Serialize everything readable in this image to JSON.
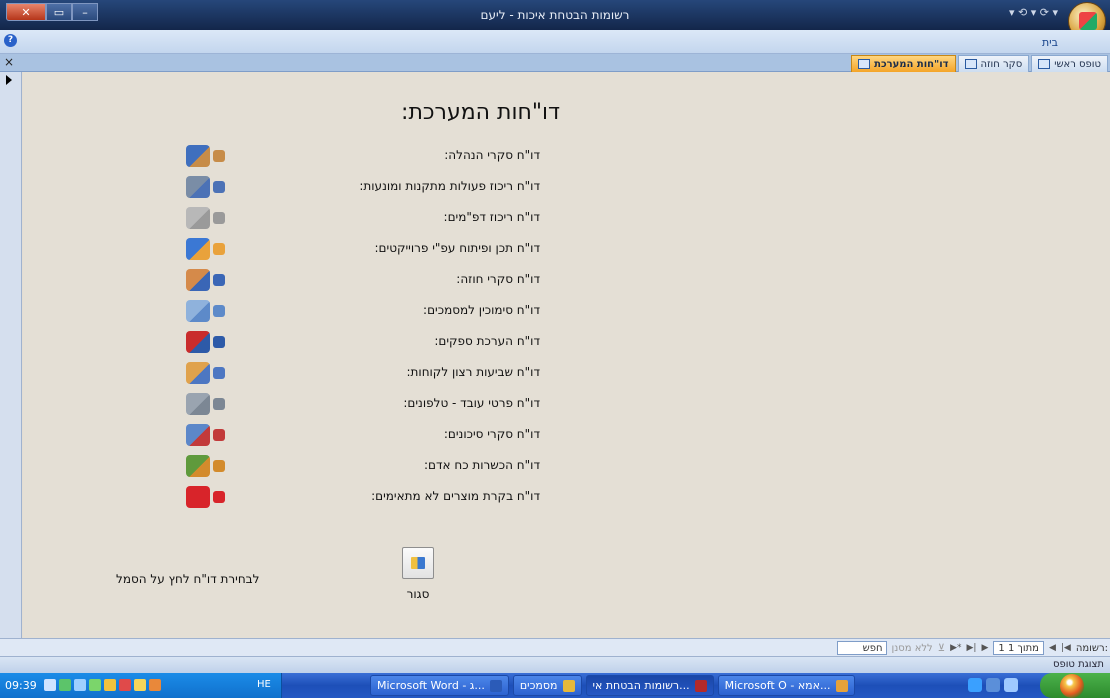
{
  "window": {
    "title": "רשומות הבטחת איכות - ליעם",
    "quick_access": "▾ ⟲ ▾ ⟳ ▾"
  },
  "ribbon": {
    "home_tab": "בית"
  },
  "object_tabs": [
    {
      "label": "דו\"חות המערכת",
      "active": true
    },
    {
      "label": "סקר חוזה",
      "active": false
    },
    {
      "label": "טופס ראשי",
      "active": false
    }
  ],
  "form": {
    "heading": "דו\"חות המערכת:",
    "reports": [
      {
        "label": "דו\"ח סקרי הנהלה:",
        "icon": "management-icon",
        "color_a": "#3f6fbe",
        "color_b": "#c78c48"
      },
      {
        "label": "דו\"ח ריכוז פעולות מתקנות ומונעות:",
        "icon": "tools-icon",
        "color_a": "#7a8da6",
        "color_b": "#4c72b6"
      },
      {
        "label": "דו\"ח ריכוז דפ\"מים:",
        "icon": "documents-icon",
        "color_a": "#b8b8b8",
        "color_b": "#9a9a9a"
      },
      {
        "label": "דו\"ח תכן ופיתוח עפ\"י פרוייקטים:",
        "icon": "org-chart-icon",
        "color_a": "#3b78d4",
        "color_b": "#e9a23b"
      },
      {
        "label": "דו\"ח סקרי חוזה:",
        "icon": "handshake-icon",
        "color_a": "#d58a4a",
        "color_b": "#3a66b6"
      },
      {
        "label": "דו\"ח סימוכין למסמכים:",
        "icon": "binder-icon",
        "color_a": "#8fb2dc",
        "color_b": "#5d8ac9"
      },
      {
        "label": "דו\"ח הערכת ספקים:",
        "icon": "truck-icon",
        "color_a": "#c92c2c",
        "color_b": "#2d5aa8"
      },
      {
        "label": "דו\"ח שביעות רצון לקוחות:",
        "icon": "customers-icon",
        "color_a": "#e0a24c",
        "color_b": "#4d77c2"
      },
      {
        "label": "דו\"ח פרטי עובד - טלפונים:",
        "icon": "phone-icon",
        "color_a": "#9aa4b0",
        "color_b": "#7c8794"
      },
      {
        "label": "דו\"ח סקרי סיכונים:",
        "icon": "risk-icon",
        "color_a": "#5c87c9",
        "color_b": "#c23a3a"
      },
      {
        "label": "דו\"ח הכשרות כח אדם:",
        "icon": "people-icon",
        "color_a": "#5f9a3c",
        "color_b": "#d38b2c"
      },
      {
        "label": "דו\"ח בקרת מוצרים לא מתאימים:",
        "icon": "reject-icon",
        "color_a": "#d8242a",
        "color_b": "#d8242a"
      }
    ],
    "close_label": "סגור",
    "hint": "לבחירת דו\"ח לחץ על הסמל"
  },
  "record_nav": {
    "prefix": "רשומה:",
    "position": "1 מתוך 1",
    "no_filter": "ללא מסנן",
    "search_placeholder": "חפש"
  },
  "status": {
    "text": "תצוגת טופס"
  },
  "taskbar": {
    "clock": "09:39",
    "lang": "HE",
    "buttons": [
      {
        "label": "Microsoft Word - ג...",
        "icon_color": "#2b5bb8"
      },
      {
        "label": "מסמכים",
        "icon_color": "#e6b83a"
      },
      {
        "label": "רשומות הבטחת אי...",
        "icon_color": "#b32a2a"
      },
      {
        "label": "Microsoft O - אמא...",
        "icon_color": "#e6a23a"
      }
    ]
  }
}
